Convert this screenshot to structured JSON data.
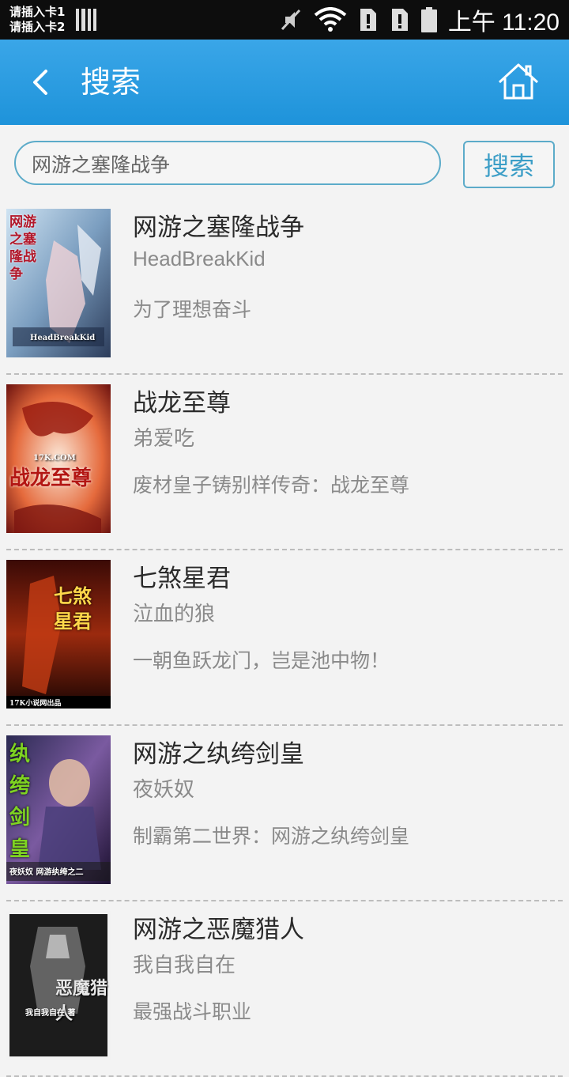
{
  "status_bar": {
    "sim1": "请插入卡1",
    "sim2": "请插入卡2",
    "time": "上午 11:20",
    "icons": [
      "sim-signal-icon",
      "mute-icon",
      "wifi-icon",
      "sim1-alert-icon",
      "sim2-alert-icon",
      "battery-icon"
    ]
  },
  "header": {
    "title": "搜索",
    "back_icon": "chevron-left-icon",
    "home_icon": "home-icon"
  },
  "search": {
    "value": "网游之塞隆战争",
    "button_label": "搜索"
  },
  "colors": {
    "header_top": "#3aa6e8",
    "header_bottom": "#1e93da",
    "accent": "#3c9ec7",
    "background": "#f3f3f3"
  },
  "results": [
    {
      "title": "网游之塞隆战争",
      "author": "HeadBreakKid",
      "description": "为了理想奋斗",
      "cover_text": "网游之塞隆战争",
      "cover_sub": "HeadBreakKid"
    },
    {
      "title": "战龙至尊",
      "author": "弟爱吃",
      "description": "废材皇子铸别样传奇：战龙至尊",
      "cover_text": "战龙至尊",
      "cover_sub": "17K.COM"
    },
    {
      "title": "七煞星君",
      "author": "泣血的狼",
      "description": "一朝鱼跃龙门，岂是池中物！",
      "cover_text": "七煞星君",
      "cover_sub": "17K小说网出品"
    },
    {
      "title": "网游之纨绔剑皇",
      "author": "夜妖奴",
      "description": "制霸第二世界：网游之纨绔剑皇",
      "cover_text": "纨绔剑皇",
      "cover_sub": "夜妖奴 网游纨绔之二"
    },
    {
      "title": "网游之恶魔猎人",
      "author": "我自我自在",
      "description": "最强战斗职业",
      "cover_text": "恶魔猎人",
      "cover_sub": "我自我自在 著"
    }
  ]
}
